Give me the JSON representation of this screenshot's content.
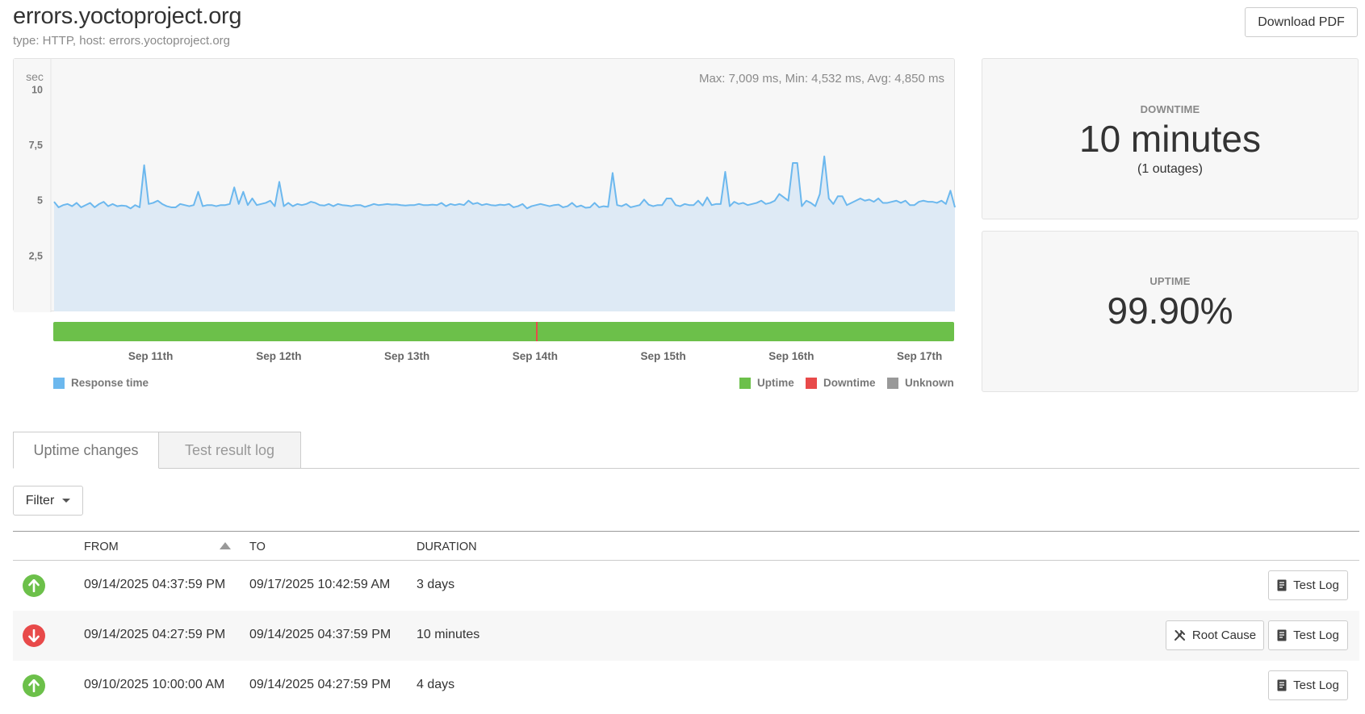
{
  "header": {
    "title": "errors.yoctoproject.org",
    "subtitle": "type: HTTP, host: errors.yoctoproject.org",
    "download_pdf_label": "Download PDF"
  },
  "chart": {
    "unit_label": "sec",
    "stats_text": "Max: 7,009 ms, Min: 4,532 ms, Avg: 4,850 ms",
    "colors": {
      "response_line": "#6cb8ee",
      "response_fill": "#deeaf5",
      "uptime": "#6cc04a",
      "downtime": "#e84a4a",
      "unknown": "#999999"
    }
  },
  "legend": {
    "response_time": "Response time",
    "uptime": "Uptime",
    "downtime": "Downtime",
    "unknown": "Unknown"
  },
  "chart_data": {
    "type": "area",
    "title": "",
    "ylabel": "sec",
    "xlabel": "",
    "ylim": [
      0,
      11.4
    ],
    "y_ticks": [
      2.5,
      5,
      7.5,
      10
    ],
    "y_tick_labels": [
      "2,5",
      "5",
      "7,5",
      "10"
    ],
    "x_tick_labels": [
      "Sep 11th",
      "Sep 12th",
      "Sep 13th",
      "Sep 14th",
      "Sep 15th",
      "Sep 16th",
      "Sep 17th"
    ],
    "x_range_days": [
      10.42,
      17.45
    ],
    "series": [
      {
        "name": "Response time",
        "x_start_day": 10.42,
        "x_end_day": 17.45,
        "values": [
          4.95,
          4.7,
          4.8,
          4.85,
          4.75,
          4.9,
          4.7,
          4.8,
          4.9,
          4.7,
          4.85,
          4.95,
          4.75,
          4.85,
          4.75,
          4.78,
          4.76,
          4.65,
          4.8,
          4.7,
          6.6,
          4.85,
          4.9,
          5.0,
          4.85,
          4.75,
          4.7,
          4.7,
          4.85,
          4.8,
          4.75,
          4.8,
          5.4,
          4.75,
          4.8,
          4.8,
          4.75,
          4.8,
          4.8,
          4.85,
          5.6,
          4.85,
          5.4,
          4.8,
          5.1,
          4.8,
          4.85,
          4.9,
          5.0,
          4.75,
          5.85,
          4.75,
          4.9,
          4.75,
          4.85,
          4.8,
          4.85,
          4.95,
          4.9,
          4.8,
          4.78,
          4.85,
          4.75,
          4.85,
          4.8,
          4.78,
          4.75,
          4.8,
          4.8,
          4.72,
          4.78,
          4.85,
          4.8,
          4.82,
          4.85,
          4.82,
          4.83,
          4.8,
          4.78,
          4.8,
          4.8,
          4.85,
          4.8,
          4.8,
          4.82,
          4.8,
          4.9,
          4.75,
          4.85,
          4.8,
          4.85,
          4.8,
          5.0,
          4.85,
          4.9,
          4.8,
          4.85,
          4.8,
          4.78,
          4.82,
          4.8,
          4.85,
          4.7,
          4.75,
          4.85,
          4.65,
          4.75,
          4.8,
          4.85,
          4.8,
          4.75,
          4.8,
          4.82,
          4.7,
          4.75,
          4.9,
          4.72,
          4.78,
          4.68,
          4.7,
          4.9,
          4.7,
          4.75,
          4.72,
          6.25,
          4.8,
          4.75,
          4.85,
          4.7,
          4.75,
          4.8,
          5.05,
          4.82,
          4.75,
          4.8,
          4.8,
          5.1,
          5.1,
          4.8,
          4.75,
          4.85,
          4.8,
          4.8,
          5.0,
          4.78,
          5.15,
          4.8,
          4.85,
          4.85,
          6.3,
          4.75,
          4.95,
          4.85,
          4.9,
          4.8,
          4.85,
          4.9,
          5.0,
          4.85,
          4.9,
          5.0,
          5.3,
          5.15,
          5.0,
          6.7,
          6.7,
          4.75,
          5.0,
          4.9,
          4.75,
          5.3,
          7.0,
          5.1,
          4.85,
          5.2,
          5.2,
          4.8,
          4.9,
          5.0,
          5.1,
          5.0,
          5.05,
          4.95,
          5.1,
          4.9,
          4.9,
          4.95,
          5.0,
          4.9,
          5.0,
          4.8,
          4.8,
          4.95,
          5.0,
          4.95,
          4.95,
          4.9,
          5.0,
          4.85,
          5.45,
          4.7
        ]
      }
    ],
    "uptime_bar": {
      "segments": [
        {
          "status": "Uptime",
          "from_day": 10.42,
          "to_day": 14.1854
        },
        {
          "status": "Downtime",
          "from_day": 14.1854,
          "to_day": 14.1924
        },
        {
          "status": "Uptime",
          "from_day": 14.1924,
          "to_day": 17.45
        }
      ]
    },
    "grid": false,
    "legend_position": "bottom"
  },
  "stats": {
    "downtime_label": "DOWNTIME",
    "downtime_value": "10 minutes",
    "downtime_sub": "(1 outages)",
    "uptime_label": "UPTIME",
    "uptime_value": "99.90%"
  },
  "tabs": [
    {
      "label": "Uptime changes",
      "active": true
    },
    {
      "label": "Test result log",
      "active": false
    }
  ],
  "filter_label": "Filter",
  "table": {
    "headers": {
      "from": "FROM",
      "to": "TO",
      "duration": "DURATION"
    },
    "rows": [
      {
        "status": "up",
        "from": "09/14/2025 04:37:59 PM",
        "to": "09/17/2025 10:42:59 AM",
        "duration": "3 days",
        "root_cause": false,
        "test_log_label": "Test Log"
      },
      {
        "status": "down",
        "from": "09/14/2025 04:27:59 PM",
        "to": "09/14/2025 04:37:59 PM",
        "duration": "10 minutes",
        "root_cause": true,
        "root_cause_label": "Root Cause",
        "test_log_label": "Test Log"
      },
      {
        "status": "up",
        "from": "09/10/2025 10:00:00 AM",
        "to": "09/14/2025 04:27:59 PM",
        "duration": "4 days",
        "root_cause": false,
        "test_log_label": "Test Log"
      }
    ]
  }
}
